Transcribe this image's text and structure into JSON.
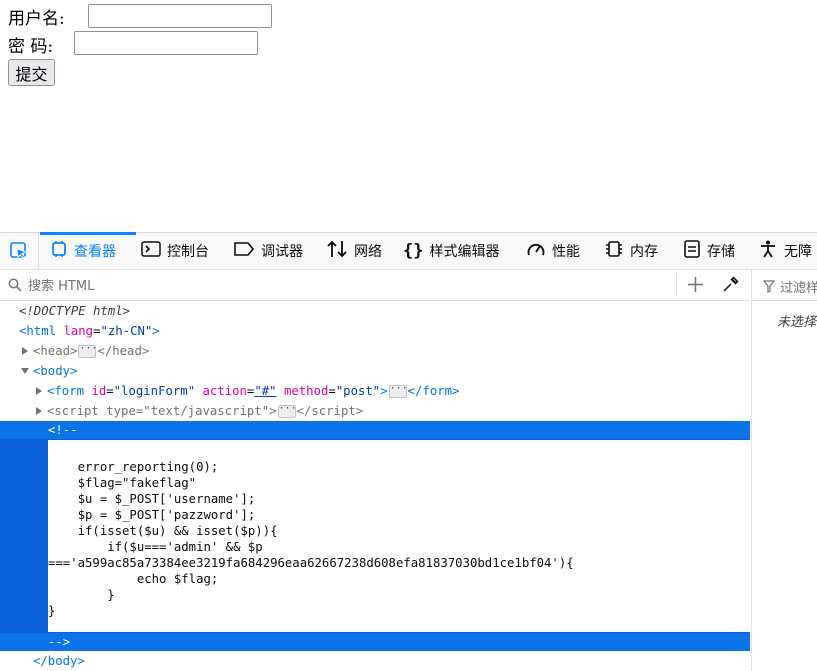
{
  "login_form": {
    "username_label": "用户名:",
    "username_value": "",
    "password_label": "密 码:",
    "password_value": "",
    "submit_label": "提交"
  },
  "devtools": {
    "tabs": [
      {
        "id": "inspector",
        "label": "查看器",
        "icon": "inspector-icon",
        "active": true
      },
      {
        "id": "console",
        "label": "控制台",
        "icon": "console-icon",
        "active": false
      },
      {
        "id": "debugger",
        "label": "调试器",
        "icon": "debugger-icon",
        "active": false
      },
      {
        "id": "network",
        "label": "网络",
        "icon": "network-icon",
        "active": false
      },
      {
        "id": "style-editor",
        "label": "样式编辑器",
        "icon": "braces-icon",
        "active": false
      },
      {
        "id": "performance",
        "label": "性能",
        "icon": "performance-gauge-icon",
        "active": false
      },
      {
        "id": "memory",
        "label": "内存",
        "icon": "memory-chip-icon",
        "active": false
      },
      {
        "id": "storage",
        "label": "存储",
        "icon": "storage-icon",
        "active": false
      },
      {
        "id": "accessibility",
        "label": "无障",
        "icon": "accessibility-icon",
        "active": false
      }
    ],
    "search_placeholder": "搜索 HTML",
    "rules_filter_placeholder": "过滤样",
    "rules_empty_text": "未选择",
    "markup": {
      "doctype": "<!DOCTYPE html>",
      "html_tag": "html",
      "html_lang_attr": "lang",
      "html_lang_val": "\"zh-CN\"",
      "head_tag": "head",
      "body_tag": "body",
      "form_tag": "form",
      "form_attrs": [
        {
          "name": "id",
          "value": "\"loginForm\""
        },
        {
          "name": "action",
          "value": "\"#\""
        },
        {
          "name": "method",
          "value": "\"post\""
        }
      ],
      "script_tag": "script",
      "script_type_attr": "type",
      "script_type_val": "\"text/javascript\"",
      "comment_open": "<!--",
      "comment_close": "-->",
      "comment_lines": [
        "",
        "    error_reporting(0);",
        "    $flag=\"fakeflag\"",
        "    $u = $_POST['username'];",
        "    $p = $_POST['pazzword'];",
        "    if(isset($u) && isset($p)){",
        "        if($u==='admin' && $p",
        "==='a599ac85a73384ee3219fa684296eaa62667238d608efa81837030bd1ce1bf04'){",
        "            echo $flag;",
        "        }",
        "}"
      ],
      "body_close": "</body>"
    }
  },
  "colors": {
    "accent": "#0a84ff",
    "selection": "#0a60d6",
    "tag": "#0074e8",
    "attr": "#dd00a9",
    "attr_value": "#003eaa"
  }
}
